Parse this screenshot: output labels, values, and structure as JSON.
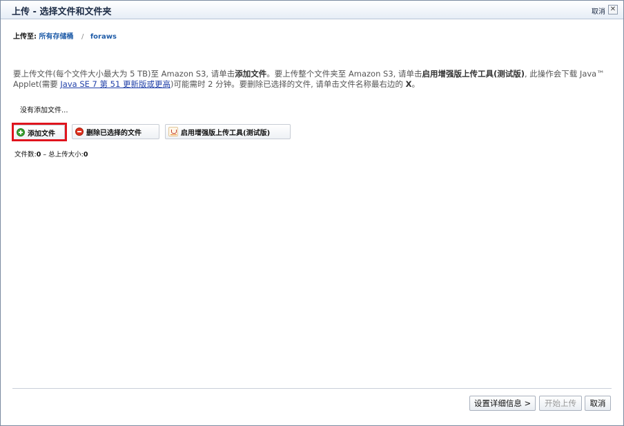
{
  "dialog": {
    "title": "上传 - 选择文件和文件夹",
    "cancel_link": "取消",
    "close_glyph": "✕"
  },
  "breadcrumb": {
    "label": "上传至:",
    "root": "所有存储桶",
    "separator": "/",
    "bucket": "foraws"
  },
  "instructions": {
    "part1": "要上传文件(每个文件大小最大为 5 TB)至 Amazon S3, 请单击",
    "add_files_bold": "添加文件",
    "part2": "。要上传整个文件夹至 Amazon S3, 请单击",
    "enhanced_bold": "启用增强版上传工具(测试版)",
    "part3": ", 此操作会下载 Java™ Applet(需要 ",
    "java_link": "Java SE 7 第 51 更新版或更高",
    "part4": ")可能需时 2 分钟。要删除已选择的文件, 请单击文件名称最右边的 ",
    "x_bold": "X",
    "part5": "。"
  },
  "no_files_text": "没有添加文件...",
  "toolbar": {
    "add_files": "添加文件",
    "remove_selected": "删除已选择的文件",
    "enable_enhanced": "启用增强版上传工具(测试版)"
  },
  "stats": {
    "files_label": "文件数:",
    "files_count": "0",
    "dash": "–",
    "total_label": "总上传大小:",
    "total_size": "0"
  },
  "footer": {
    "set_details": "设置详细信息 >",
    "start_upload": "开始上传",
    "cancel": "取消"
  },
  "colors": {
    "highlight": "#e0141d",
    "link": "#1f5ca8"
  }
}
